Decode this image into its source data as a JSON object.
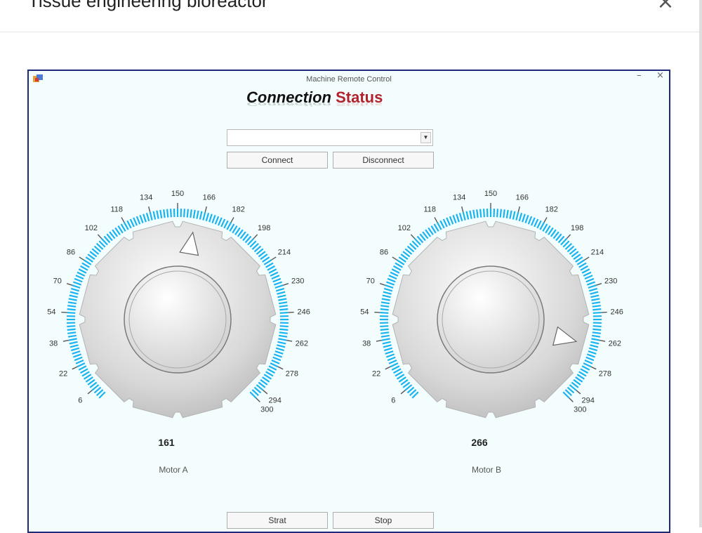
{
  "modal": {
    "title": "Tissue engineering bioreactor",
    "close_label": "×"
  },
  "window": {
    "title": "Machine Remote Control",
    "minimize_label": "–",
    "close_label": "×"
  },
  "heading": {
    "word1": "Connection",
    "word2": "Status"
  },
  "port_select": {
    "value": "",
    "arrow": "▼"
  },
  "buttons": {
    "connect": "Connect",
    "disconnect": "Disconnect",
    "start": "Strat",
    "stop": "Stop"
  },
  "dials": {
    "min": 0,
    "max": 300,
    "tick_labels": [
      "6",
      "22",
      "38",
      "54",
      "70",
      "86",
      "102",
      "118",
      "134",
      "150",
      "166",
      "182",
      "198",
      "214",
      "230",
      "246",
      "262",
      "278",
      "294",
      "300"
    ],
    "motor_a": {
      "label": "Motor A",
      "value": 161
    },
    "motor_b": {
      "label": "Motor B",
      "value": 266
    }
  },
  "colors": {
    "scale": "#18b4f0",
    "status": "#b3212c",
    "window_border": "#1e2a78",
    "window_bg": "#f3fdfd"
  }
}
